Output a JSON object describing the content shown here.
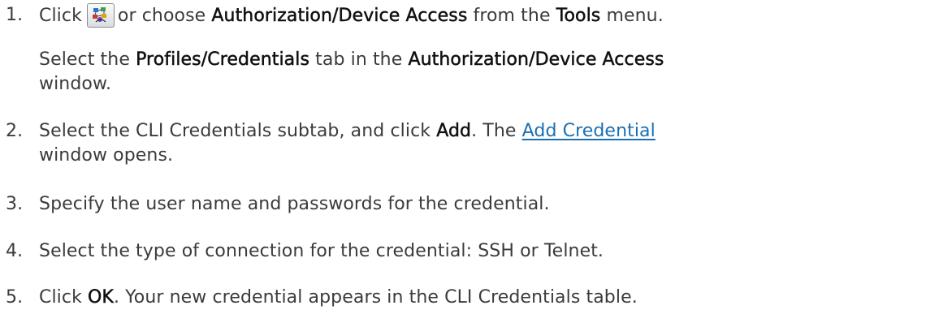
{
  "steps": [
    {
      "number": "1.",
      "line1": {
        "t1": "Click",
        "icon": "authorization-device-access-toolbar-icon",
        "t2": "or choose ",
        "b1": "Authorization/Device Access",
        "t3": " from the ",
        "b2": "Tools",
        "t4": " menu."
      },
      "para2": {
        "t1": "Select the ",
        "b1": "Profiles/Credentials",
        "t2": " tab in the ",
        "b2": "Authorization/Device Access",
        "t3": "window."
      }
    },
    {
      "number": "2.",
      "t1": "Select the CLI Credentials subtab, and click ",
      "b1": "Add",
      "t2": ". The ",
      "link": "Add Credential",
      "t3": "window opens."
    },
    {
      "number": "3.",
      "text": "Specify the user name and passwords for the credential."
    },
    {
      "number": "4.",
      "text": "Select the type of connection for the credential: SSH or Telnet."
    },
    {
      "number": "5.",
      "t1": "Click ",
      "b1": "OK",
      "t2": ". Your new credential appears in the CLI Credentials table."
    }
  ],
  "colors": {
    "text": "#3b3b3b",
    "bold_text": "#111111",
    "link": "#1a6fb3"
  }
}
